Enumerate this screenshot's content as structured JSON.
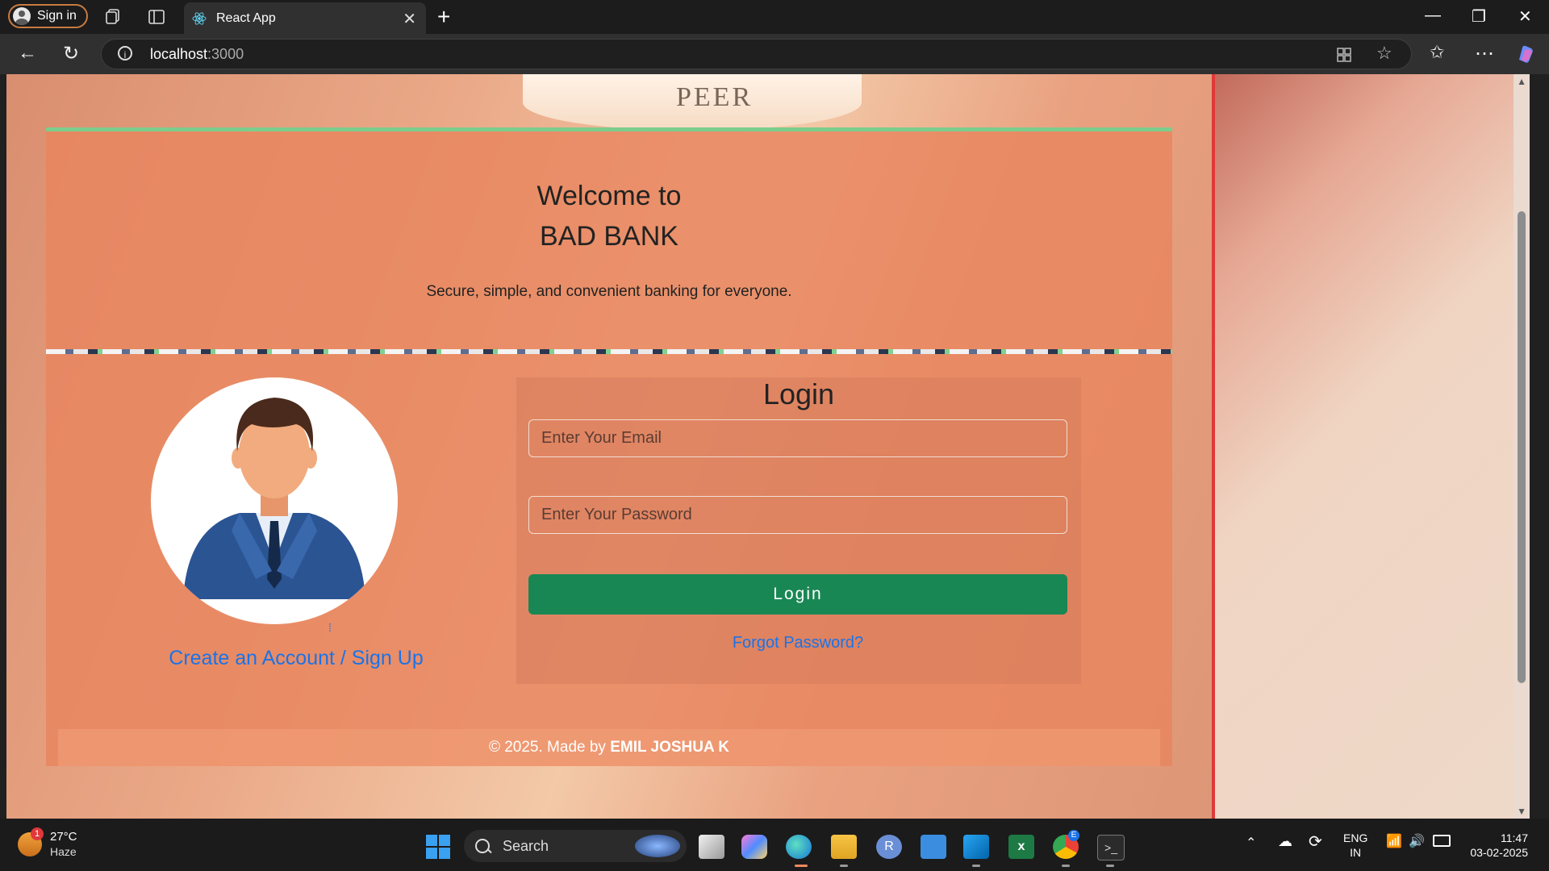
{
  "browser": {
    "signin_label": "Sign in",
    "tab_title": "React App",
    "url_host": "localhost",
    "url_port": ":3000"
  },
  "page": {
    "welcome_line1": "Welcome to",
    "welcome_line2": "BAD BANK",
    "tagline": "Secure, simple, and convenient banking for everyone.",
    "coin_text": "PEER",
    "login": {
      "title": "Login",
      "email_placeholder": "Enter Your Email",
      "password_placeholder": "Enter Your Password",
      "button_label": "Login",
      "forgot_label": "Forgot Password?"
    },
    "signup_label": "Create an Account / Sign Up",
    "footer_prefix": "© 2025. Made by ",
    "footer_author": "EMIL JOSHUA K"
  },
  "taskbar": {
    "weather_temp": "27°C",
    "weather_cond": "Haze",
    "weather_badge": "1",
    "search_label": "Search",
    "lang_line1": "ENG",
    "lang_line2": "IN",
    "time": "11:47",
    "date": "03-02-2025",
    "copilot_badge": "E"
  },
  "colors": {
    "accent_green": "#198754",
    "link_blue": "#1a73e8",
    "card_bg": "#e8855e"
  }
}
